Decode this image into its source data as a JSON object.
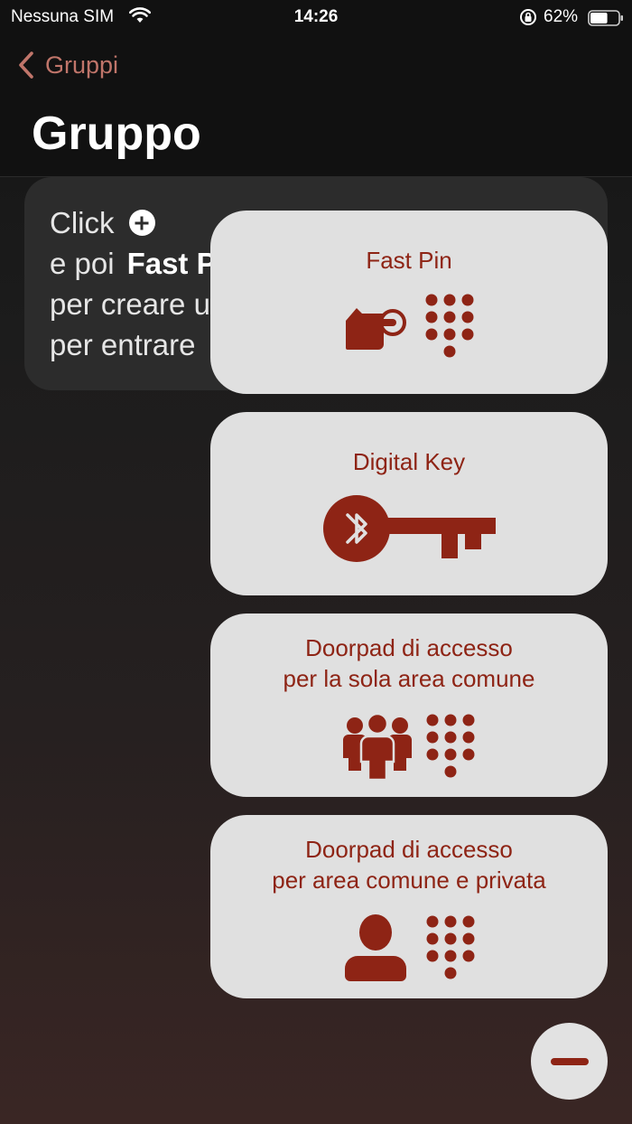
{
  "status_bar": {
    "carrier": "Nessuna SIM",
    "time": "14:26",
    "battery_pct": "62%",
    "battery_level": 0.62
  },
  "nav": {
    "back_label": "Gruppi",
    "title": "Gruppo"
  },
  "info": {
    "line1": "Click",
    "line2_prefix": "e poi",
    "line2_bold": "Fast P",
    "line3": "per creare u",
    "line4": "per entrare"
  },
  "options": [
    {
      "title": "Fast Pin",
      "icons": [
        "hand-press-icon",
        "keypad-icon"
      ]
    },
    {
      "title": "Digital Key",
      "icons": [
        "bluetooth-key-icon"
      ]
    },
    {
      "title_line1": "Doorpad di accesso",
      "title_line2": "per la sola area comune",
      "icons": [
        "group-icon",
        "keypad-icon"
      ]
    },
    {
      "title_line1": "Doorpad di accesso",
      "title_line2": "per area comune e privata",
      "icons": [
        "person-icon",
        "keypad-icon"
      ]
    }
  ],
  "colors": {
    "accent": "#8e2415",
    "back_link": "#c0756a",
    "card_bg": "#e0e0e0",
    "info_bg": "#2c2c2c"
  }
}
